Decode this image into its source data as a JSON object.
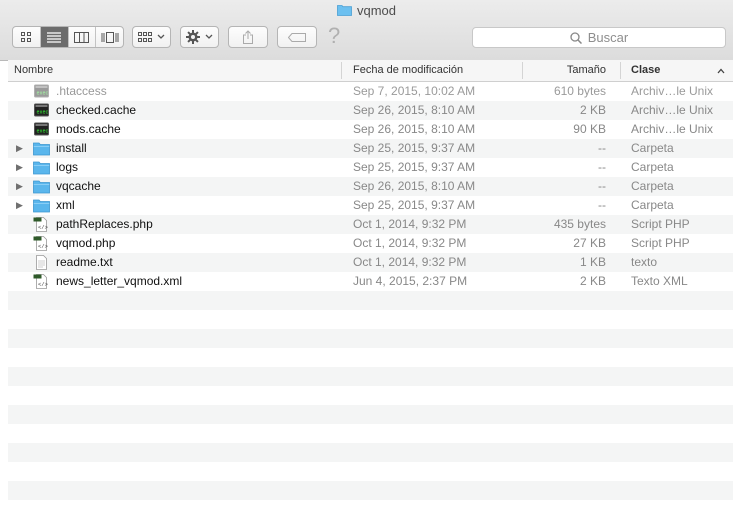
{
  "window": {
    "title": "vqmod"
  },
  "toolbar": {
    "icon_view": "icon-view-icon",
    "list_view": "list-view-icon",
    "column_view": "column-view-icon",
    "coverflow_view": "coverflow-view-icon",
    "arrange": "arrange-icon",
    "action": "gear-icon",
    "share": "share-icon",
    "tags": "tag-icon",
    "help": "?",
    "search_placeholder": "Buscar"
  },
  "columns": {
    "name": "Nombre",
    "date": "Fecha de modificación",
    "size": "Tamaño",
    "kind": "Clase"
  },
  "files": [
    {
      "name": ".htaccess",
      "date": "Sep 7, 2015, 10:02 AM",
      "size": "610 bytes",
      "kind": "Archiv…le Unix",
      "type": "exec",
      "hidden": true
    },
    {
      "name": "checked.cache",
      "date": "Sep 26, 2015, 8:10 AM",
      "size": "2 KB",
      "kind": "Archiv…le Unix",
      "type": "exec"
    },
    {
      "name": "mods.cache",
      "date": "Sep 26, 2015, 8:10 AM",
      "size": "90 KB",
      "kind": "Archiv…le Unix",
      "type": "exec"
    },
    {
      "name": "install",
      "date": "Sep 25, 2015, 9:37 AM",
      "size": "--",
      "kind": "Carpeta",
      "type": "folder"
    },
    {
      "name": "logs",
      "date": "Sep 25, 2015, 9:37 AM",
      "size": "--",
      "kind": "Carpeta",
      "type": "folder"
    },
    {
      "name": "vqcache",
      "date": "Sep 26, 2015, 8:10 AM",
      "size": "--",
      "kind": "Carpeta",
      "type": "folder"
    },
    {
      "name": "xml",
      "date": "Sep 25, 2015, 9:37 AM",
      "size": "--",
      "kind": "Carpeta",
      "type": "folder"
    },
    {
      "name": "pathReplaces.php",
      "date": "Oct 1, 2014, 9:32 PM",
      "size": "435 bytes",
      "kind": "Script PHP",
      "type": "code"
    },
    {
      "name": "vqmod.php",
      "date": "Oct 1, 2014, 9:32 PM",
      "size": "27 KB",
      "kind": "Script PHP",
      "type": "code"
    },
    {
      "name": "readme.txt",
      "date": "Oct 1, 2014, 9:32 PM",
      "size": "1 KB",
      "kind": "texto",
      "type": "text"
    },
    {
      "name": "news_letter_vqmod.xml",
      "date": "Jun 4, 2015, 2:37 PM",
      "size": "2 KB",
      "kind": "Texto XML",
      "type": "code"
    }
  ],
  "colors": {
    "folder": "#5ab6ec",
    "accent": "#3b99fc"
  }
}
